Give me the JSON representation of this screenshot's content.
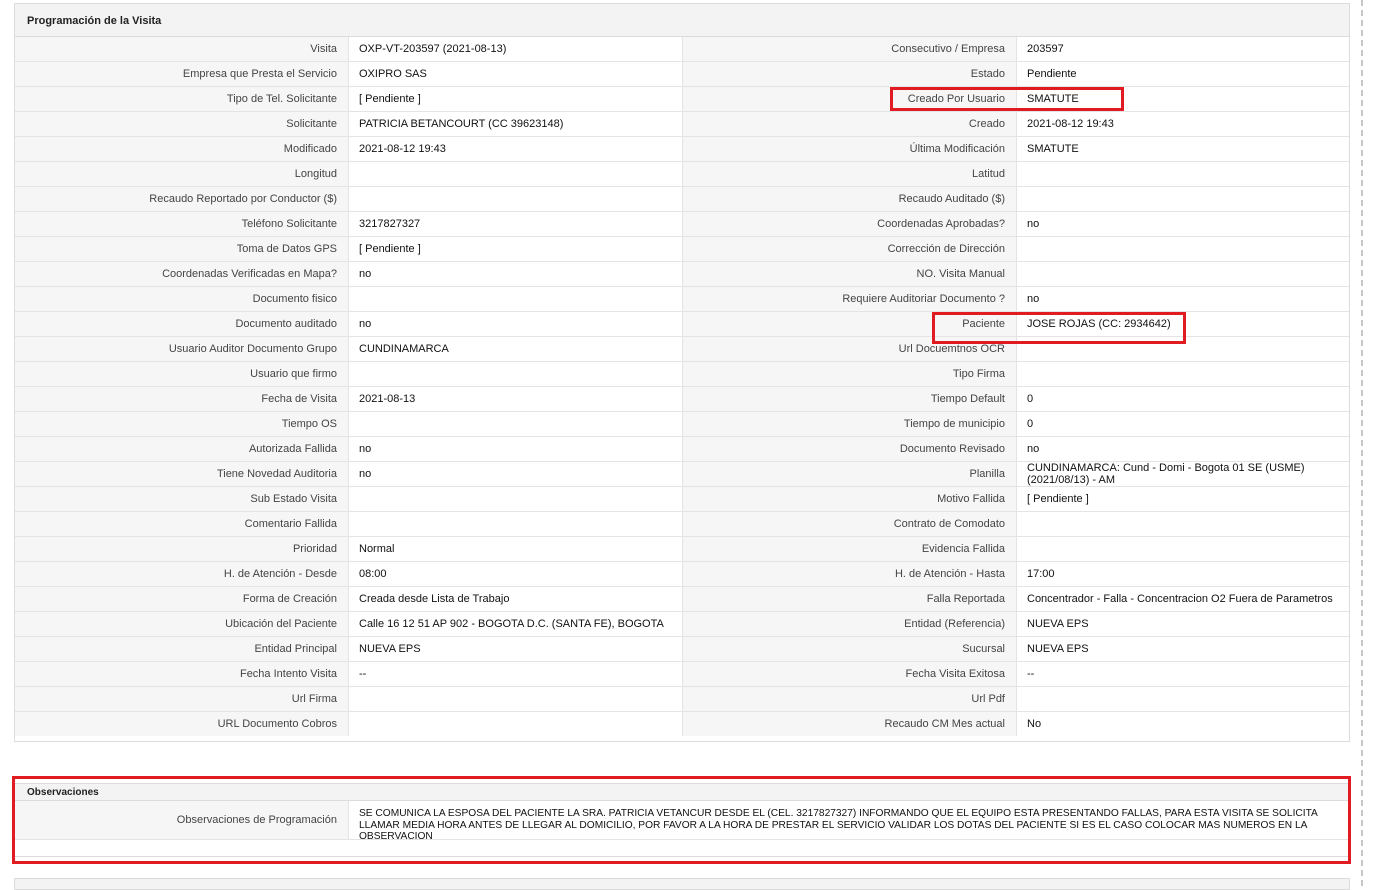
{
  "programacion": {
    "title": "Programación de la Visita",
    "rows": [
      {
        "l1": "Visita",
        "v1": "OXP-VT-203597 (2021-08-13)",
        "l2": "Consecutivo / Empresa",
        "v2": "203597"
      },
      {
        "l1": "Empresa que Presta el Servicio",
        "v1": "OXIPRO SAS",
        "l2": "Estado",
        "v2": "Pendiente"
      },
      {
        "l1": "Tipo de Tel. Solicitante",
        "v1": "[ Pendiente ]",
        "l2": "Creado Por Usuario",
        "v2": "SMATUTE"
      },
      {
        "l1": "Solicitante",
        "v1": "PATRICIA BETANCOURT (CC 39623148)",
        "l2": "Creado",
        "v2": "2021-08-12 19:43"
      },
      {
        "l1": "Modificado",
        "v1": "2021-08-12 19:43",
        "l2": "Última Modificación",
        "v2": " SMATUTE"
      },
      {
        "l1": "Longitud",
        "v1": "",
        "l2": "Latitud",
        "v2": ""
      },
      {
        "l1": "Recaudo Reportado por Conductor ($)",
        "v1": "",
        "l2": "Recaudo Auditado ($)",
        "v2": ""
      },
      {
        "l1": "Teléfono Solicitante",
        "v1": "3217827327",
        "l2": "Coordenadas Aprobadas?",
        "v2": " no"
      },
      {
        "l1": "Toma de Datos GPS",
        "v1": "[ Pendiente ]",
        "l2": "Corrección de Dirección",
        "v2": ""
      },
      {
        "l1": "Coordenadas Verificadas en Mapa?",
        "v1": " no",
        "l2": "NO. Visita Manual",
        "v2": ""
      },
      {
        "l1": "Documento fisico",
        "v1": "",
        "l2": "Requiere Auditoriar Documento ?",
        "v2": " no"
      },
      {
        "l1": "Documento auditado",
        "v1": " no",
        "l2": "Paciente",
        "v2": "JOSE ROJAS (CC: 2934642)"
      },
      {
        "l1": "Usuario Auditor Documento Grupo",
        "v1": "CUNDINAMARCA",
        "l2": "Url Docuemtnos OCR",
        "v2": ""
      },
      {
        "l1": "Usuario que firmo",
        "v1": "",
        "l2": "Tipo Firma",
        "v2": ""
      },
      {
        "l1": "Fecha de Visita",
        "v1": " 2021-08-13",
        "l2": "Tiempo Default",
        "v2": "0"
      },
      {
        "l1": "Tiempo OS",
        "v1": "",
        "l2": "Tiempo de municipio",
        "v2": "0"
      },
      {
        "l1": "Autorizada Fallida",
        "v1": " no",
        "l2": "Documento Revisado",
        "v2": " no"
      },
      {
        "l1": "Tiene Novedad Auditoria",
        "v1": " no",
        "l2": "Planilla",
        "v2": "CUNDINAMARCA: Cund - Domi - Bogota 01 SE (USME) (2021/08/13) - AM"
      },
      {
        "l1": "Sub Estado Visita",
        "v1": "",
        "l2": "Motivo Fallida",
        "v2": "[ Pendiente ]"
      },
      {
        "l1": "Comentario Fallida",
        "v1": "",
        "l2": "Contrato de Comodato",
        "v2": ""
      },
      {
        "l1": "Prioridad",
        "v1": "Normal",
        "l2": "Evidencia Fallida",
        "v2": ""
      },
      {
        "l1": "H. de Atención - Desde",
        "v1": "08:00",
        "l2": "H. de Atención - Hasta",
        "v2": "17:00"
      },
      {
        "l1": "Forma de Creación",
        "v1": "Creada desde Lista de Trabajo",
        "l2": "Falla Reportada",
        "v2": "Concentrador - Falla - Concentracion O2 Fuera de Parametros"
      },
      {
        "l1": "Ubicación del Paciente",
        "v1": "Calle 16 12 51 AP 902 - BOGOTA D.C. (SANTA FE), BOGOTA",
        "l2": "Entidad (Referencia)",
        "v2": "NUEVA EPS"
      },
      {
        "l1": "Entidad Principal",
        "v1": "NUEVA EPS",
        "l2": "Sucursal",
        "v2": "NUEVA EPS"
      },
      {
        "l1": "Fecha Intento Visita",
        "v1": " --",
        "l2": "Fecha Visita Exitosa",
        "v2": " --"
      },
      {
        "l1": "Url Firma",
        "v1": "",
        "l2": "Url Pdf",
        "v2": ""
      },
      {
        "l1": "URL Documento Cobros",
        "v1": "",
        "l2": "Recaudo CM Mes actual",
        "v2": "No"
      }
    ]
  },
  "observaciones": {
    "title": "Observaciones",
    "label": "Observaciones de Programación",
    "value": "   SE COMUNICA LA ESPOSA DEL PACIENTE LA SRA. PATRICIA VETANCUR DESDE EL (CEL. 3217827327) INFORMANDO QUE EL EQUIPO ESTA PRESENTANDO FALLAS, PARA ESTA VISITA SE SOLICITA LLAMAR MEDIA HORA ANTES DE LLEGAR AL DOMICILIO, POR FAVOR A LA HORA DE PRESTAR EL SERVICIO VALIDAR LOS DOTAS DEL PACIENTE SI ES EL CASO COLOCAR MAS NUMEROS EN LA OBSERVACION"
  },
  "highlight_color": "#e11b22"
}
